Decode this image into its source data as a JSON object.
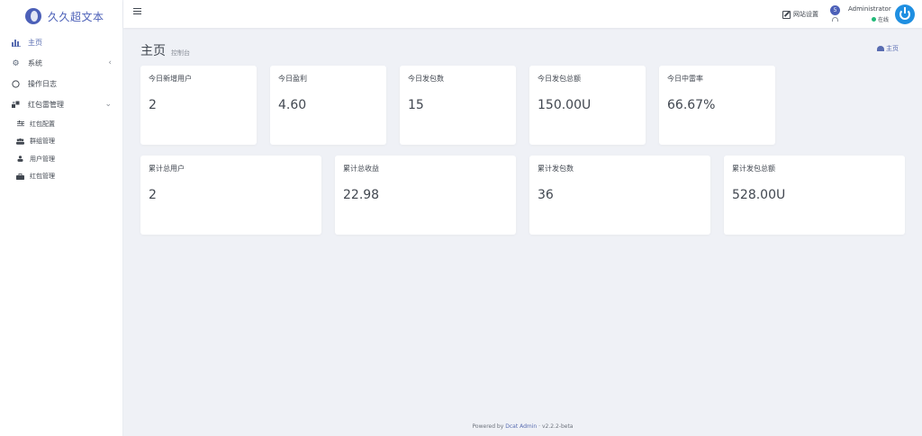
{
  "brand": {
    "name": "久久超文本"
  },
  "sidebar": {
    "items": [
      {
        "label": "主页",
        "icon": "bar-chart-icon",
        "active": true
      },
      {
        "label": "系统",
        "icon": "gear-icon",
        "has_arrow": true,
        "arrow": "‹"
      },
      {
        "label": "操作日志",
        "icon": "circle-icon"
      },
      {
        "label": "红包雷管理",
        "icon": "puzzle-icon",
        "has_arrow": true,
        "arrow": "⌄"
      }
    ],
    "sub_items": [
      {
        "label": "红包配置",
        "icon": "sliders-icon"
      },
      {
        "label": "群组管理",
        "icon": "users-icon"
      },
      {
        "label": "用户管理",
        "icon": "user-icon"
      },
      {
        "label": "红包管理",
        "icon": "briefcase-icon"
      }
    ]
  },
  "topbar": {
    "site_settings": "网站设置",
    "notification_count": "5",
    "user_name": "Administrator",
    "user_status": "在线"
  },
  "page": {
    "title": "主页",
    "subtitle": "控制台",
    "breadcrumb": "主页"
  },
  "stats_today": [
    {
      "label": "今日新增用户",
      "value": "2"
    },
    {
      "label": "今日盈利",
      "value": "4.60"
    },
    {
      "label": "今日发包数",
      "value": "15"
    },
    {
      "label": "今日发包总额",
      "value": "150.00U"
    },
    {
      "label": "今日中雷率",
      "value": "66.67%"
    }
  ],
  "stats_total": [
    {
      "label": "累计总用户",
      "value": "2"
    },
    {
      "label": "累计总收益",
      "value": "22.98"
    },
    {
      "label": "累计发包数",
      "value": "36"
    },
    {
      "label": "累计发包总额",
      "value": "528.00U"
    }
  ],
  "footer": {
    "prefix": "Powered by",
    "link": "Dcat Admin",
    "separator": "·",
    "version": "v2.2.2-beta"
  },
  "colors": {
    "accent": "#586cb1",
    "brand": "#4c60b8",
    "online": "#21b978",
    "power": "#1f8fe1",
    "background": "#eff1f6"
  }
}
